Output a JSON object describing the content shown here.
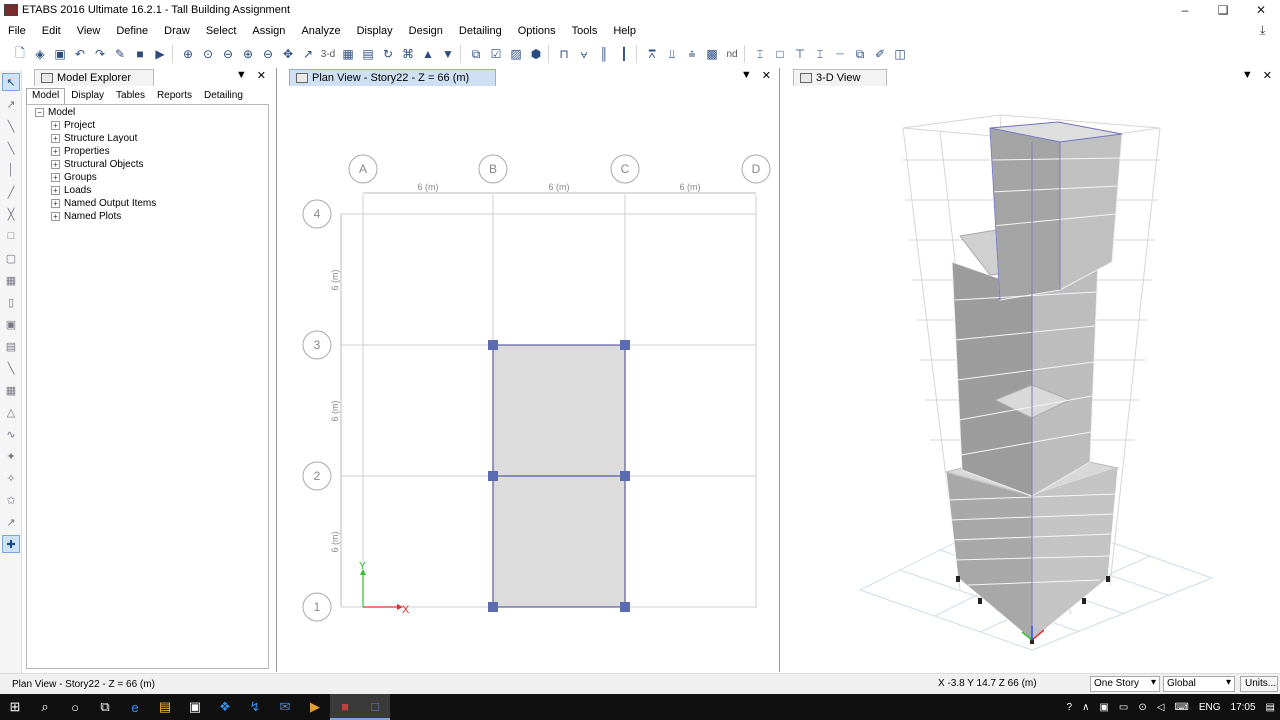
{
  "window": {
    "title": "ETABS 2016 Ultimate 16.2.1 - Tall Building Assignment",
    "controls": {
      "minimize": "–",
      "maximize": "❑",
      "close": "✕"
    }
  },
  "menu": [
    "File",
    "Edit",
    "View",
    "Define",
    "Draw",
    "Select",
    "Assign",
    "Analyze",
    "Display",
    "Design",
    "Detailing",
    "Options",
    "Tools",
    "Help"
  ],
  "toolbar": {
    "text_3d": "3-d",
    "text_nd": "nd"
  },
  "model_explorer": {
    "title": "Model Explorer",
    "tabs": [
      "Model",
      "Display",
      "Tables",
      "Reports",
      "Detailing"
    ],
    "root": "Model",
    "items": [
      "Project",
      "Structure Layout",
      "Properties",
      "Structural Objects",
      "Groups",
      "Loads",
      "Named Output Items",
      "Named Plots"
    ]
  },
  "plan_view": {
    "tab_title": "Plan View - Story22 - Z = 66 (m)",
    "column_labels": [
      "A",
      "B",
      "C",
      "D"
    ],
    "row_labels": [
      "4",
      "3",
      "2",
      "1"
    ],
    "dimension_label": "6 (m)",
    "axis_x": "X",
    "axis_y": "Y"
  },
  "view_3d": {
    "tab_title": "3-D View"
  },
  "status": {
    "left": "Plan View - Story22 - Z = 66 (m)",
    "coords": "X -3.8  Y 14.7  Z 66 (m)",
    "story_option": "One Story",
    "coord_system": "Global",
    "units_button": "Units..."
  },
  "taskbar": {
    "language": "ENG",
    "time": "17:05"
  }
}
